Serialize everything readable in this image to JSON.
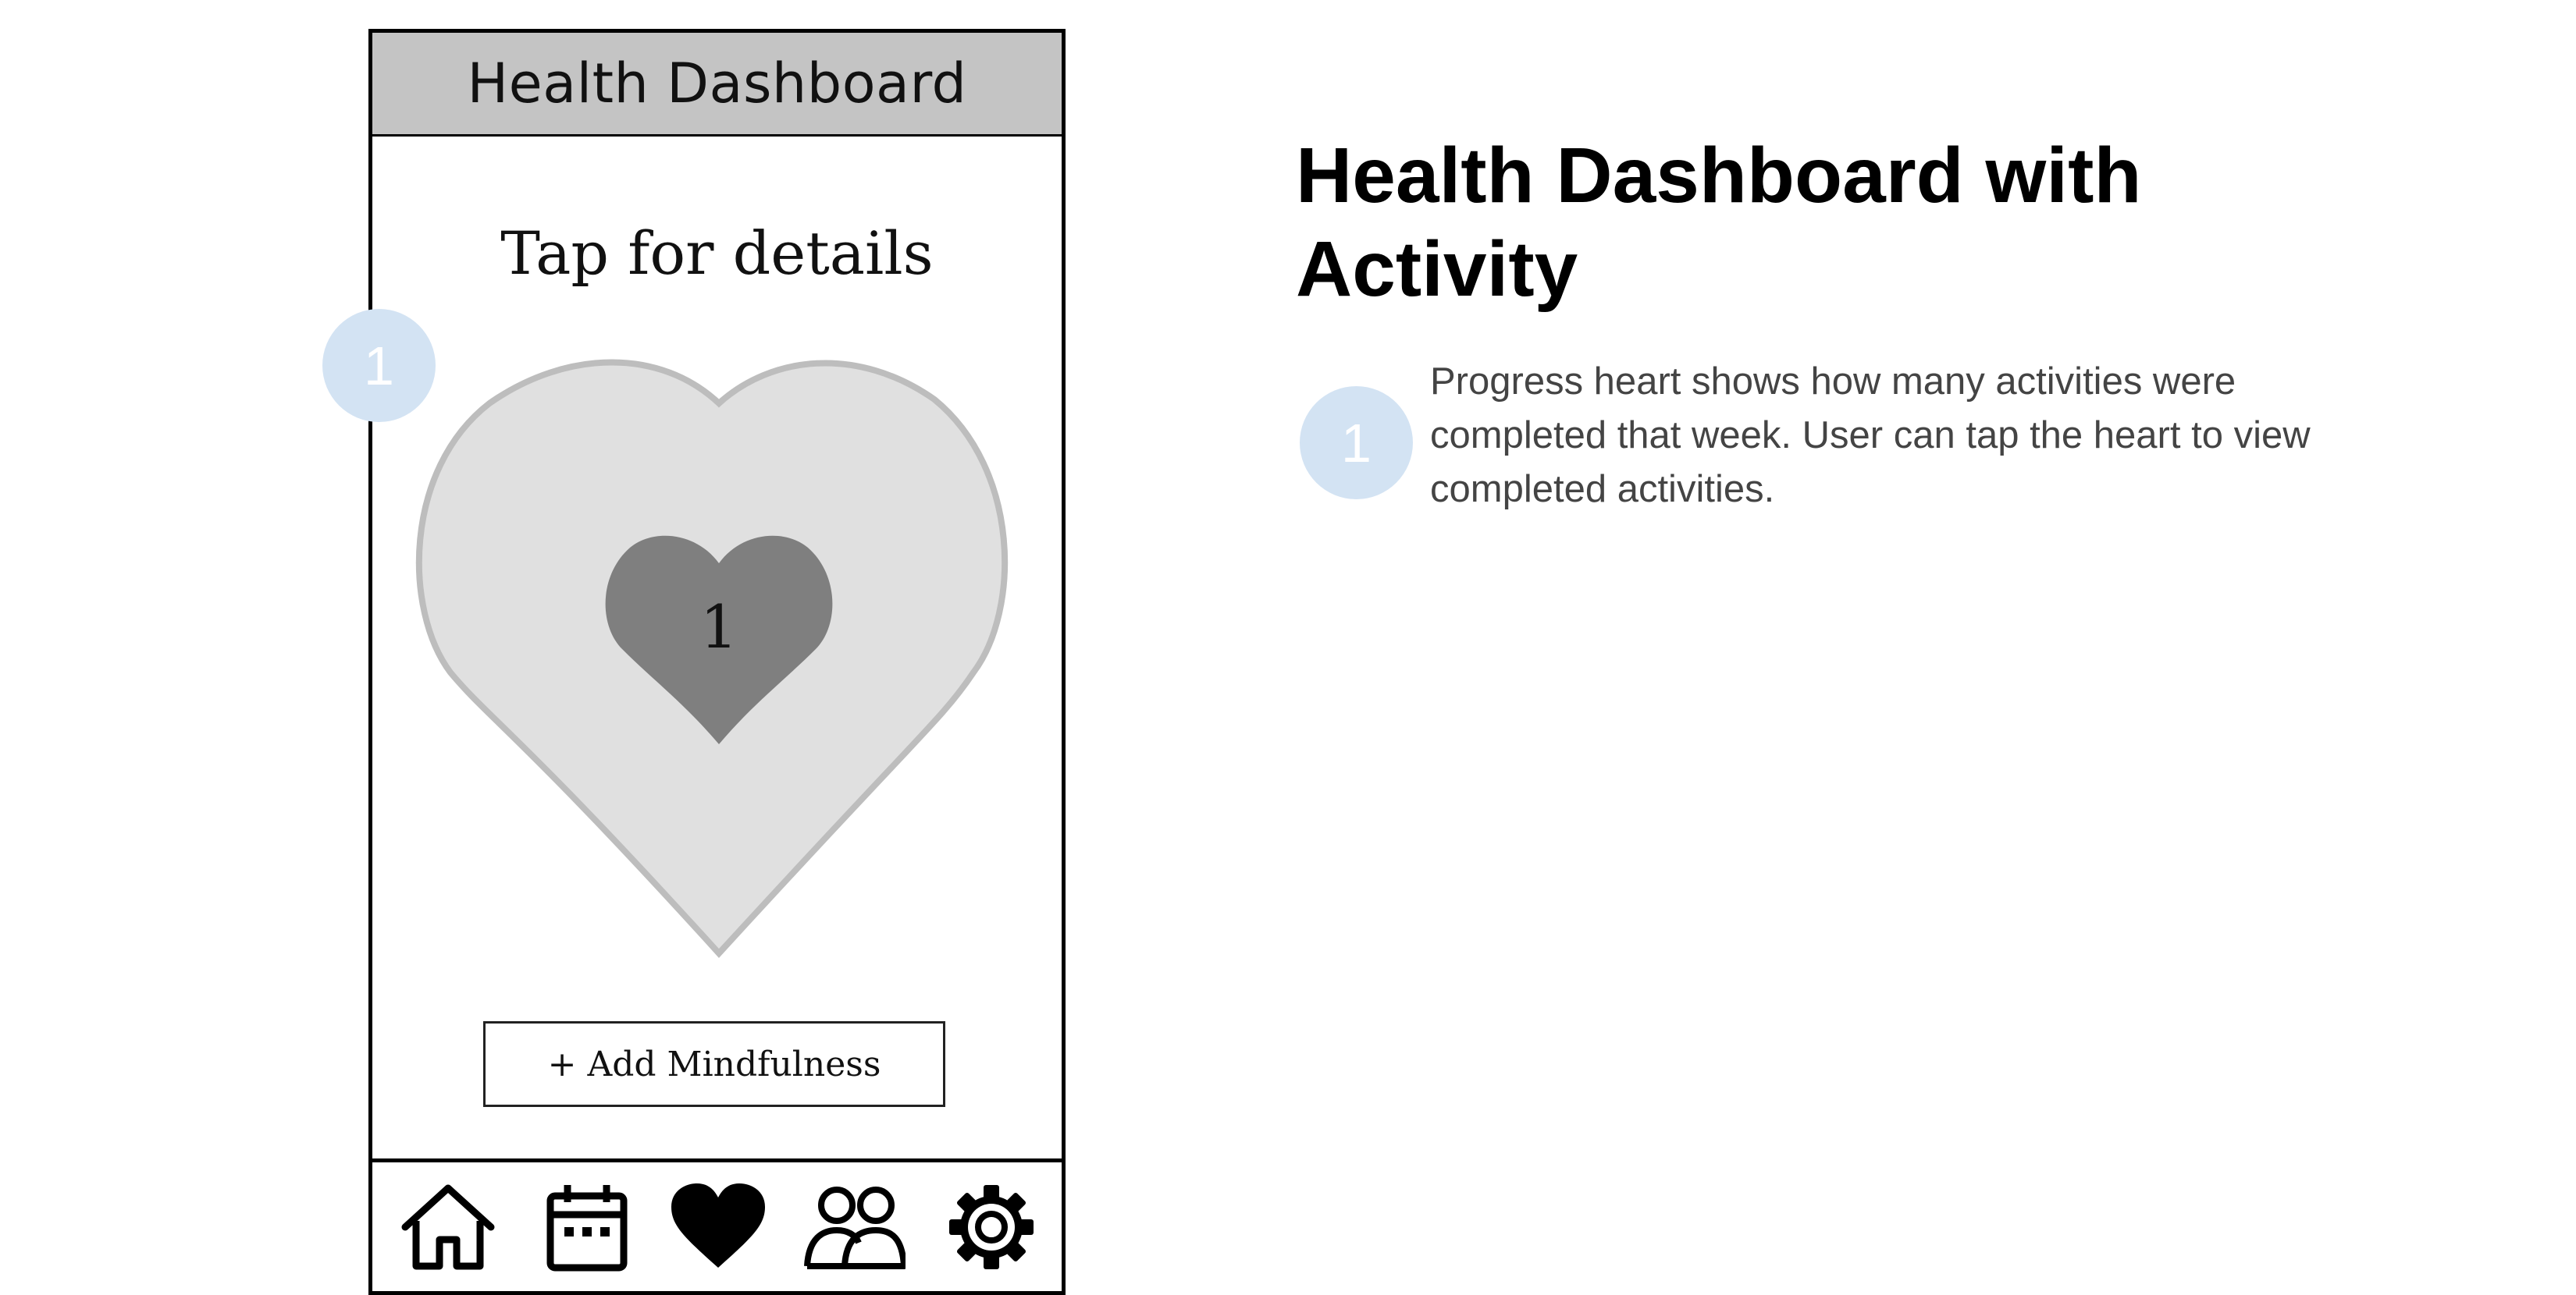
{
  "phone": {
    "title": "Health Dashboard",
    "tap_label": "Tap for details",
    "progress_count": "1",
    "add_button_label": "+ Add Mindfulness",
    "tabs": [
      {
        "icon": "home-icon"
      },
      {
        "icon": "calendar-icon"
      },
      {
        "icon": "heart-icon"
      },
      {
        "icon": "people-icon"
      },
      {
        "icon": "gear-icon"
      }
    ]
  },
  "markers": {
    "phone_marker": "1",
    "note_marker": "1"
  },
  "annotation": {
    "title": "Health Dashboard with Activity",
    "note_text": "Progress heart shows how many activities were completed that week. User can tap the heart to view completed activities."
  },
  "colors": {
    "header_bg": "#c4c4c4",
    "outer_heart_fill": "#e0e0e0",
    "outer_heart_stroke": "#bdbdbd",
    "inner_heart_fill": "#7f7f7f",
    "marker_bg": "#d3e3f3"
  }
}
